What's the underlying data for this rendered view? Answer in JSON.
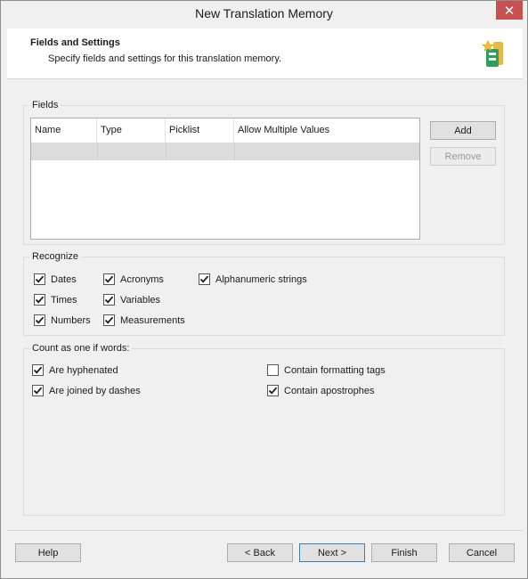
{
  "window": {
    "title": "New Translation Memory",
    "close_glyph": "✕"
  },
  "header": {
    "title": "Fields and Settings",
    "subtitle": "Specify fields and settings for this translation memory.",
    "icon": "translation-memory-icon"
  },
  "fields": {
    "group_label": "Fields",
    "columns": [
      "Name",
      "Type",
      "Picklist",
      "Allow Multiple Values"
    ],
    "rows": [
      [
        "",
        "",
        "",
        ""
      ]
    ],
    "add_label": "Add",
    "remove_label": "Remove"
  },
  "recognize": {
    "group_label": "Recognize",
    "items": [
      {
        "label": "Dates",
        "checked": true
      },
      {
        "label": "Times",
        "checked": true
      },
      {
        "label": "Numbers",
        "checked": true
      },
      {
        "label": "Acronyms",
        "checked": true
      },
      {
        "label": "Variables",
        "checked": true
      },
      {
        "label": "Measurements",
        "checked": true
      },
      {
        "label": "Alphanumeric strings",
        "checked": true
      }
    ]
  },
  "count": {
    "group_label": "Count as one if words:",
    "items": [
      {
        "label": "Are hyphenated",
        "checked": true
      },
      {
        "label": "Are joined by dashes",
        "checked": true
      },
      {
        "label": "Contain formatting tags",
        "checked": false
      },
      {
        "label": "Contain apostrophes",
        "checked": true
      }
    ]
  },
  "footer": {
    "help_label": "Help",
    "back_label": "< Back",
    "next_label": "Next >",
    "finish_label": "Finish",
    "cancel_label": "Cancel"
  }
}
